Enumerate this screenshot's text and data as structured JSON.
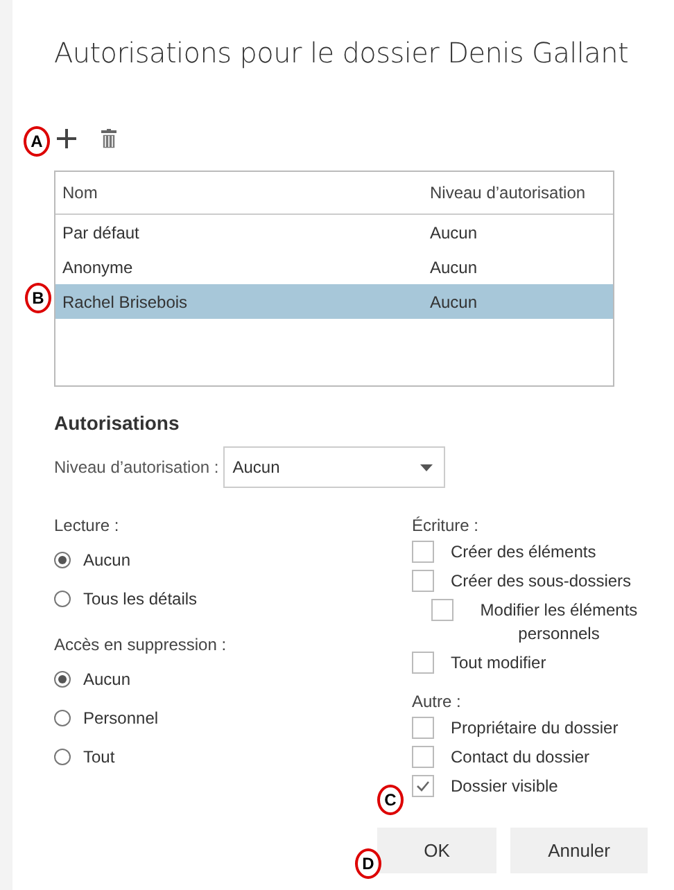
{
  "title": "Autorisations pour le dossier Denis Gallant",
  "table": {
    "columns": [
      "Nom",
      "Niveau d’autorisation"
    ],
    "rows": [
      {
        "cells": [
          "Par défaut",
          "Aucun"
        ],
        "selected": false
      },
      {
        "cells": [
          "Anonyme",
          "Aucun"
        ],
        "selected": false
      },
      {
        "cells": [
          "Rachel Brisebois",
          "Aucun"
        ],
        "selected": true
      }
    ]
  },
  "permissions": {
    "heading": "Autorisations",
    "level_label": "Niveau d’autorisation :",
    "level_value": "Aucun",
    "read": {
      "label": "Lecture :",
      "options": [
        {
          "label": "Aucun",
          "selected": true
        },
        {
          "label": "Tous les détails",
          "selected": false
        }
      ]
    },
    "delete": {
      "label": "Accès en suppression :",
      "options": [
        {
          "label": "Aucun",
          "selected": true
        },
        {
          "label": "Personnel",
          "selected": false
        },
        {
          "label": "Tout",
          "selected": false
        }
      ]
    },
    "write": {
      "label": "Écriture :",
      "items": [
        {
          "label": "Créer des éléments",
          "checked": false
        },
        {
          "label": "Créer des sous-dossiers",
          "checked": false,
          "children": [
            {
              "label": "Modifier les éléments personnels",
              "checked": false
            }
          ]
        },
        {
          "label": "Tout modifier",
          "checked": false
        }
      ]
    },
    "other": {
      "label": "Autre :",
      "items": [
        {
          "label": "Propriétaire du dossier",
          "checked": false
        },
        {
          "label": "Contact du dossier",
          "checked": false
        },
        {
          "label": "Dossier visible",
          "checked": true
        }
      ]
    }
  },
  "buttons": [
    {
      "label": "OK",
      "kind": "primary"
    },
    {
      "label": "Annuler",
      "kind": "secondary"
    }
  ],
  "callouts": [
    {
      "label": "A"
    },
    {
      "label": "B"
    },
    {
      "label": "C"
    },
    {
      "label": "D"
    }
  ]
}
